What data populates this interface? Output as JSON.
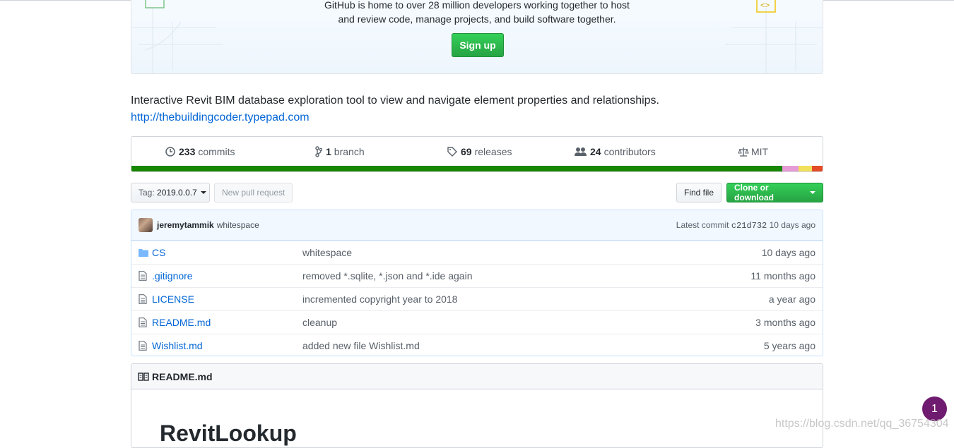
{
  "banner": {
    "line1": "GitHub is home to over 28 million developers working together to host",
    "line2": "and review code, manage projects, and build software together.",
    "signup_label": "Sign up"
  },
  "repo": {
    "description": "Interactive Revit BIM database exploration tool to view and navigate element properties and relationships.",
    "homepage": "http://thebuildingcoder.typepad.com"
  },
  "summary": {
    "commits_count": "233",
    "commits_label": "commits",
    "branch_count": "1",
    "branch_label": "branch",
    "releases_count": "69",
    "releases_label": "releases",
    "contributors_count": "24",
    "contributors_label": "contributors",
    "license": "MIT"
  },
  "languages": [
    {
      "color": "#178600",
      "share": 94
    },
    {
      "color": "#e69bd7",
      "share": 2.3
    },
    {
      "color": "#f1e05a",
      "share": 2
    },
    {
      "color": "#e34c26",
      "share": 1.5
    },
    {
      "color": "#555555",
      "share": 0.2
    }
  ],
  "toolbar": {
    "tag_prefix": "Tag:",
    "tag_value": "2019.0.0.7",
    "new_pr_label": "New pull request",
    "find_file_label": "Find file",
    "clone_label": "Clone or download"
  },
  "latest_commit": {
    "author": "jeremytammik",
    "message": "whitespace",
    "prefix": "Latest commit",
    "sha": "c21d732",
    "age": "10 days ago"
  },
  "files": [
    {
      "type": "folder",
      "name": "CS",
      "message": "whitespace",
      "age": "10 days ago"
    },
    {
      "type": "file",
      "name": ".gitignore",
      "message": "removed *.sqlite, *.json and *.ide again",
      "age": "11 months ago"
    },
    {
      "type": "file",
      "name": "LICENSE",
      "message": "incremented copyright year to 2018",
      "age": "a year ago"
    },
    {
      "type": "file",
      "name": "README.md",
      "message": "cleanup",
      "age": "3 months ago"
    },
    {
      "type": "file",
      "name": "Wishlist.md",
      "message": "added new file Wishlist.md",
      "age": "5 years ago"
    }
  ],
  "readme": {
    "header": "README.md",
    "title": "RevitLookup"
  },
  "notification_count": "1",
  "watermark": "https://blog.csdn.net/qq_36754304"
}
